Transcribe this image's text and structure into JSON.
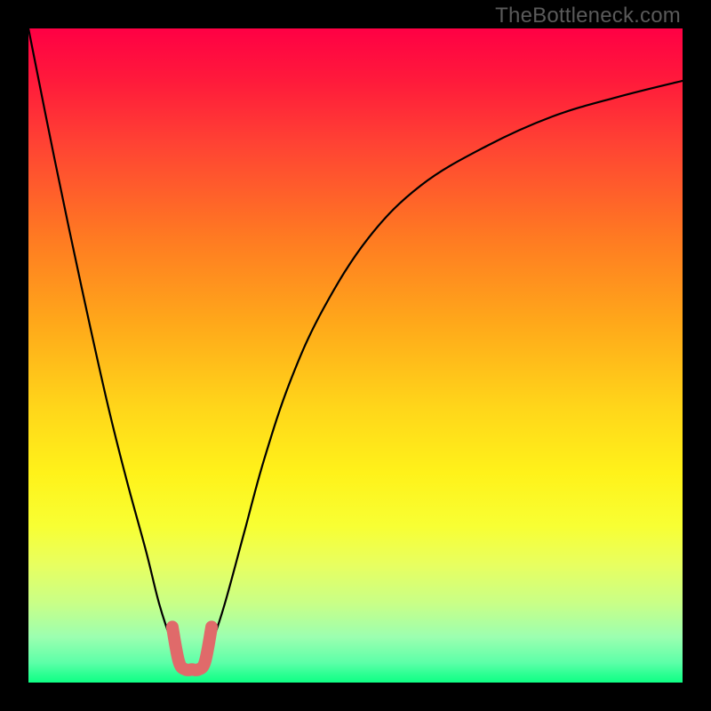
{
  "watermark": {
    "text": "TheBottleneck.com"
  },
  "chart_data": {
    "type": "line",
    "title": "",
    "xlabel": "",
    "ylabel": "",
    "xlim": [
      0,
      100
    ],
    "ylim": [
      0,
      100
    ],
    "grid": false,
    "series": [
      {
        "name": "main-curve",
        "color": "#000000",
        "x": [
          0,
          4,
          8,
          12,
          15,
          18,
          20,
          22,
          23.5,
          25,
          26.5,
          28,
          30,
          33,
          36,
          40,
          45,
          52,
          60,
          70,
          80,
          90,
          100
        ],
        "y": [
          100,
          80,
          61,
          43,
          31,
          20,
          12,
          6,
          3,
          2,
          3,
          6,
          12,
          23,
          34,
          46,
          57,
          68,
          76,
          82,
          86.5,
          89.5,
          92
        ]
      },
      {
        "name": "bottleneck-marker",
        "color": "#e06a6a",
        "x": [
          22,
          23,
          24,
          25,
          26,
          27,
          28
        ],
        "y": [
          8.5,
          3.2,
          2,
          2,
          2,
          3.2,
          8.5
        ]
      }
    ],
    "minimum_x": 25,
    "legend": false
  }
}
